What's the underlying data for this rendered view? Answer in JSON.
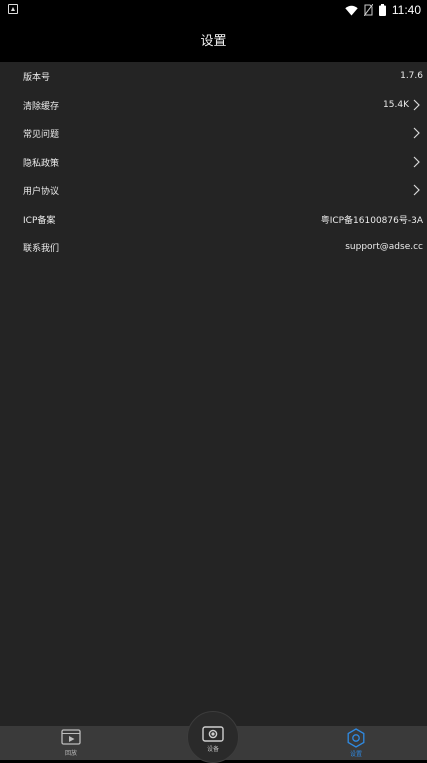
{
  "status_bar": {
    "time": "11:40",
    "left_icon": "app-notification-icon",
    "icons": [
      "wifi-icon",
      "no-sim-icon",
      "battery-icon"
    ]
  },
  "header": {
    "title": "设置"
  },
  "settings": {
    "items": [
      {
        "label": "版本号",
        "value": "1.7.6",
        "arrow": false
      },
      {
        "label": "清除缓存",
        "value": "15.4K",
        "arrow": true
      },
      {
        "label": "常见问题",
        "value": "",
        "arrow": true
      },
      {
        "label": "隐私政策",
        "value": "",
        "arrow": true
      },
      {
        "label": "用户协议",
        "value": "",
        "arrow": true
      },
      {
        "label": "ICP备案",
        "value": "粤ICP备16100876号-3A",
        "arrow": false
      },
      {
        "label": "联系我们",
        "value": "support@adse.cc",
        "arrow": false
      }
    ]
  },
  "tabbar": {
    "tabs": [
      {
        "label": "回放",
        "icon": "playback-icon",
        "active": false
      },
      {
        "label": "设备",
        "icon": "camera-device-icon",
        "active": false
      },
      {
        "label": "设置",
        "icon": "settings-gear-icon",
        "active": true
      }
    ],
    "colors": {
      "active": "#2f8ae2",
      "inactive": "#bdbdbd"
    }
  }
}
